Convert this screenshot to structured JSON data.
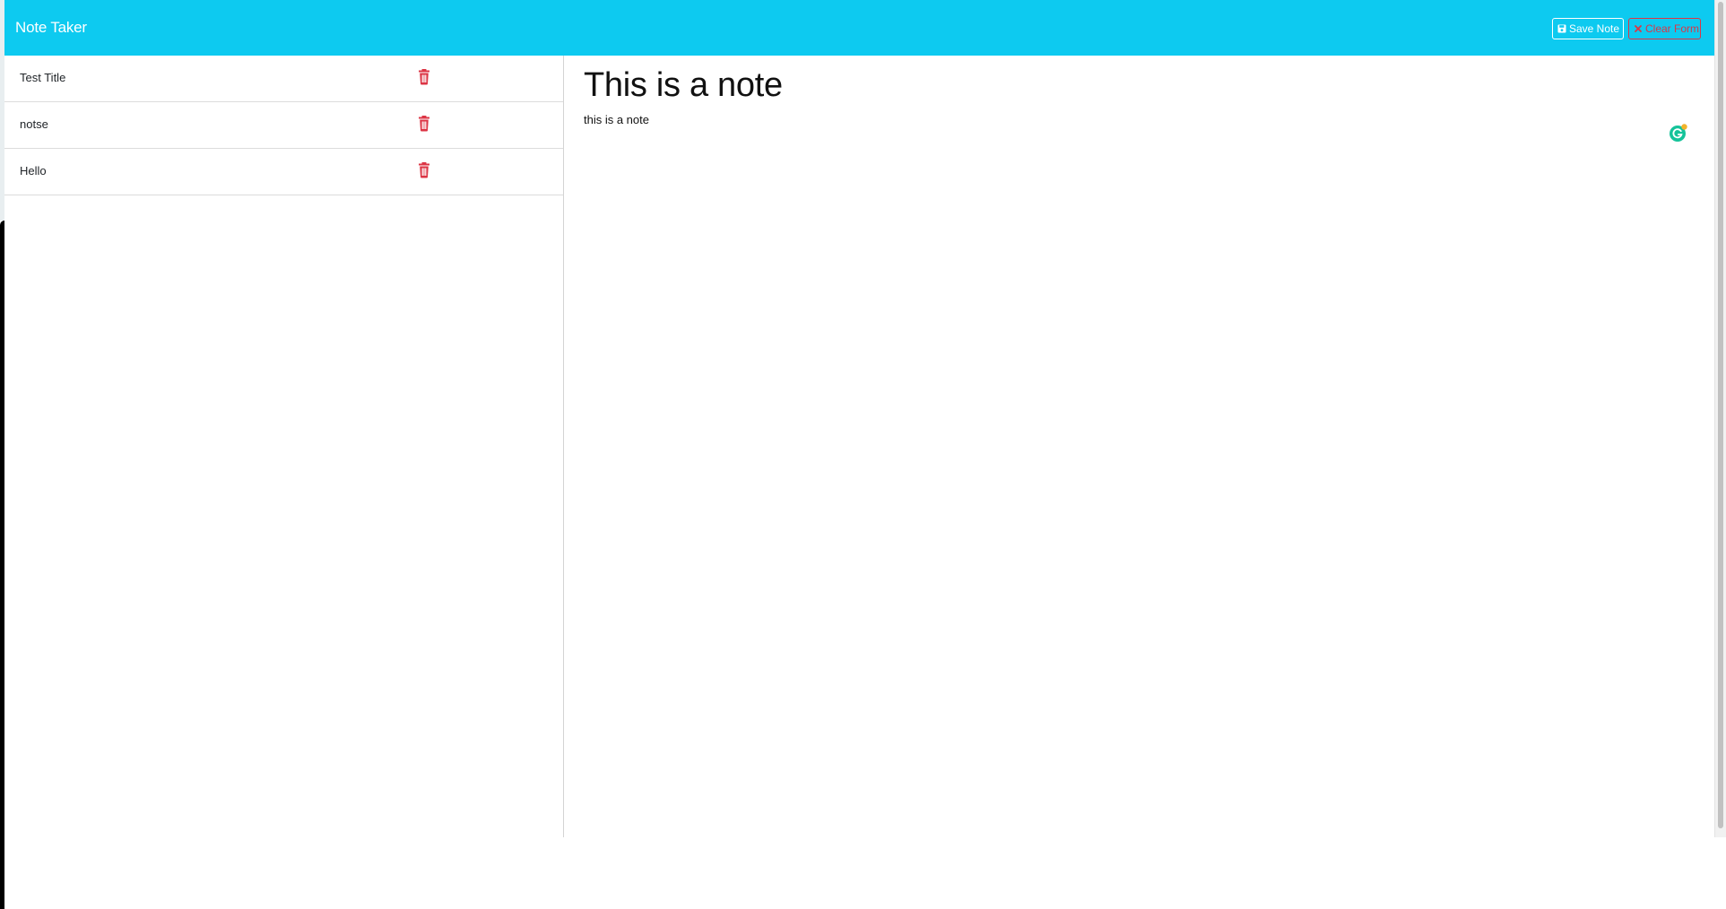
{
  "navbar": {
    "brand": "Note Taker",
    "save_label": "Save Note",
    "clear_label": "Clear Form",
    "background": "#0dcaf0"
  },
  "notes": [
    {
      "title": "Test Title"
    },
    {
      "title": "notse"
    },
    {
      "title": "Hello"
    }
  ],
  "active_note": {
    "title": "This is a note",
    "text": "this is a note"
  },
  "icons": {
    "save": "floppy-disk-icon",
    "clear": "x-icon",
    "delete": "trash-icon",
    "assistant": "grammarly-icon"
  },
  "colors": {
    "danger": "#dc3545",
    "assistant": "#15c39a"
  }
}
